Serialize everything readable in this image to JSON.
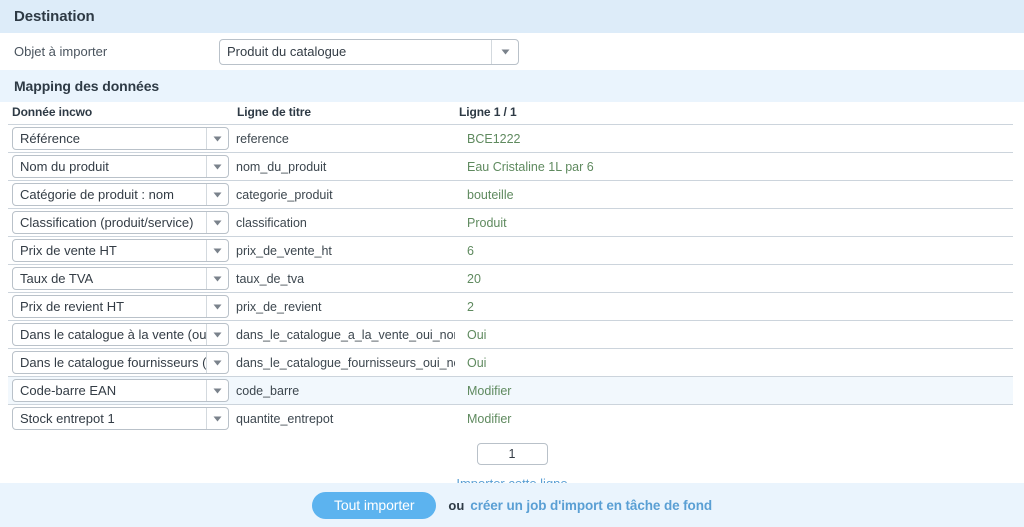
{
  "destination": {
    "section_title": "Destination",
    "field_label": "Objet à importer",
    "selected_object": "Produit du catalogue",
    "arrow_icon": "chevron-down-icon"
  },
  "mapping": {
    "section_title": "Mapping des données",
    "columns": {
      "source": "Donnée incwo",
      "header": "Ligne de titre",
      "value": "Ligne 1 / 1"
    },
    "rows": [
      {
        "source": "Référence",
        "header": "reference",
        "value": "BCE1222"
      },
      {
        "source": "Nom du produit",
        "header": "nom_du_produit",
        "value": "Eau Cristaline 1L par 6"
      },
      {
        "source": "Catégorie de produit : nom",
        "header": "categorie_produit",
        "value": "bouteille"
      },
      {
        "source": "Classification (produit/service)",
        "header": "classification",
        "value": "Produit"
      },
      {
        "source": "Prix de vente HT",
        "header": "prix_de_vente_ht",
        "value": "6"
      },
      {
        "source": "Taux de TVA",
        "header": "taux_de_tva",
        "value": "20"
      },
      {
        "source": "Prix de revient HT",
        "header": "prix_de_revient",
        "value": "2"
      },
      {
        "source": "Dans le catalogue à la vente (oui/non)",
        "header": "dans_le_catalogue_a_la_vente_oui_non_",
        "value": "Oui"
      },
      {
        "source": "Dans le catalogue fournisseurs (oui/non)",
        "header": "dans_le_catalogue_fournisseurs_oui_non_",
        "value": "Oui"
      },
      {
        "source": "Code-barre EAN",
        "header": "code_barre",
        "value": "Modifier"
      },
      {
        "source": "Stock entrepot 1",
        "header": "quantite_entrepot",
        "value": "Modifier"
      }
    ],
    "hovered_row_index": 9
  },
  "row_import": {
    "line_number_value": "1",
    "import_line_link": "Importer cette ligne"
  },
  "footer": {
    "import_all_button": "Tout importer",
    "separator": "ou",
    "background_job_link": "créer un job d'import en tâche de fond"
  },
  "colors": {
    "band_destination": "#ddecf9",
    "band_mapping": "#eaf4fd",
    "footer_bar": "#eaf4fd",
    "primary_button": "#5cb3ef",
    "link": "#5a9fd4",
    "value_text": "#5f8a5f",
    "row_hover": "#f2f8fd",
    "row_border": "#ccd4dc"
  }
}
